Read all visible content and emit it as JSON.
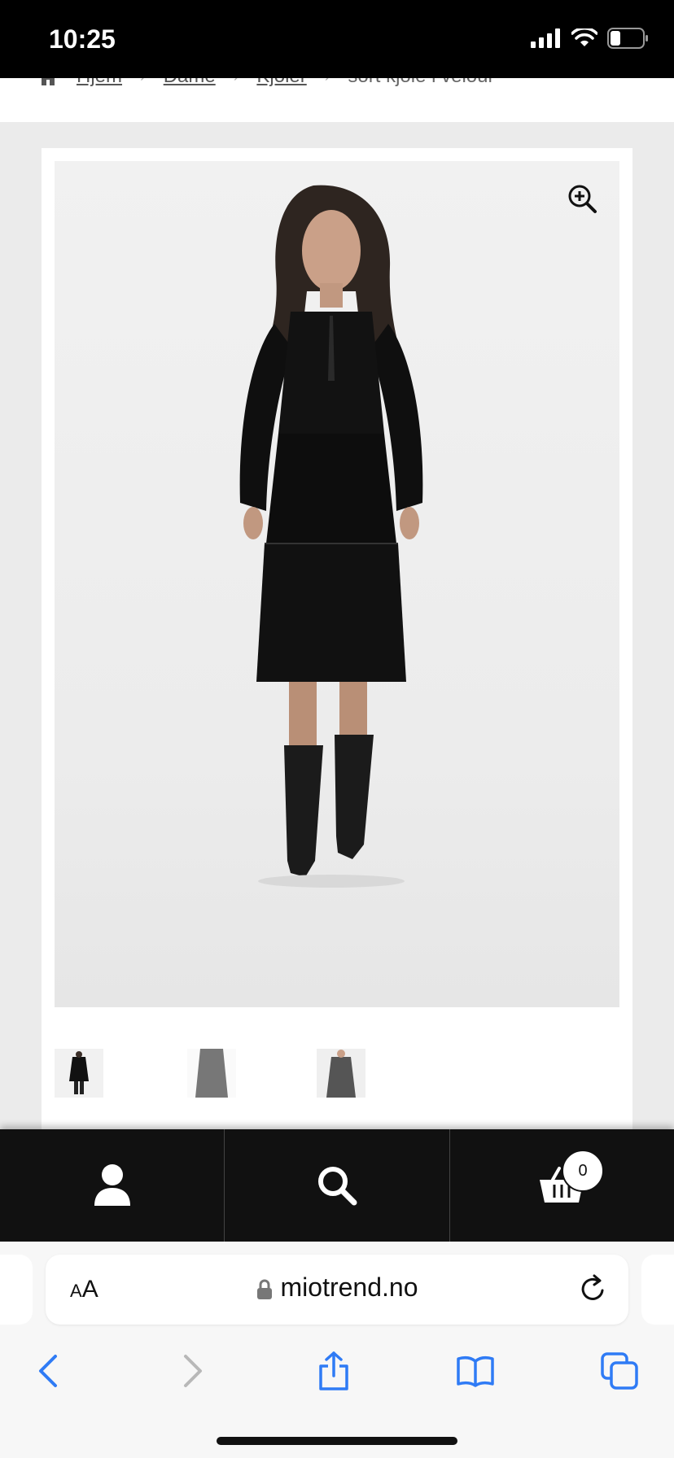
{
  "status_bar": {
    "time": "10:25"
  },
  "breadcrumb": {
    "items": [
      "Hjem",
      "Dame",
      "Kjoler"
    ],
    "current": "sort kjole i velour"
  },
  "product": {
    "image_alt": "Model i sort velourkjole med høye skinnstøvler",
    "zoom_icon": "zoom-in-icon",
    "thumbnail_count": 3
  },
  "bottom_nav": {
    "items": [
      {
        "name": "account",
        "icon": "user-icon"
      },
      {
        "name": "search",
        "icon": "search-icon"
      },
      {
        "name": "cart",
        "icon": "basket-icon"
      }
    ],
    "cart_count": "0"
  },
  "browser": {
    "text_size_label": "AA",
    "domain": "miotrend.no"
  },
  "colors": {
    "accent_blue": "#2f7bf5",
    "bar_dark": "#111111"
  }
}
